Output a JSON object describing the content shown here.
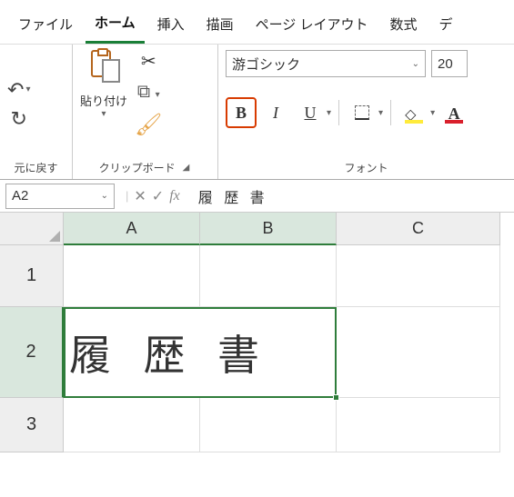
{
  "tabs": {
    "file": "ファイル",
    "home": "ホーム",
    "insert": "挿入",
    "draw": "描画",
    "pagelayout": "ページ レイアウト",
    "formulas": "数式",
    "data": "デ"
  },
  "ribbon": {
    "undo_group": "元に戻す",
    "clipboard": {
      "paste": "貼り付け",
      "label": "クリップボード"
    },
    "font": {
      "name": "游ゴシック",
      "size": "20",
      "label": "フォント",
      "bold": "B",
      "italic": "I",
      "underline": "U",
      "fontcolor_letter": "A"
    }
  },
  "formula_bar": {
    "name_box": "A2",
    "value": "履 歴 書"
  },
  "columns": {
    "a": "A",
    "b": "B",
    "c": "C"
  },
  "rows": {
    "r1": "1",
    "r2": "2",
    "r3": "3"
  },
  "cells": {
    "a2b2": "履 歴 書"
  }
}
